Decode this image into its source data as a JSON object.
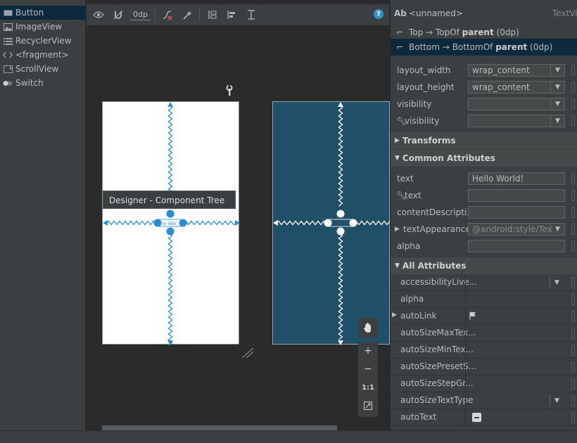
{
  "palette": {
    "items": [
      {
        "label": "Button",
        "icon": "button-icon",
        "selected": true
      },
      {
        "label": "ImageView",
        "icon": "image-icon",
        "selected": false
      },
      {
        "label": "RecyclerView",
        "icon": "list-icon",
        "selected": false
      },
      {
        "label": "<fragment>",
        "icon": "code-icon",
        "selected": false
      },
      {
        "label": "ScrollView",
        "icon": "scroll-icon",
        "selected": false
      },
      {
        "label": "Switch",
        "icon": "toggle-icon",
        "selected": false
      }
    ]
  },
  "toolbar": {
    "default_margin": "0dp",
    "help_label": "?"
  },
  "canvas": {
    "tooltip": "Designer - Component Tree",
    "widget_text": "lo Wor"
  },
  "zoom": {
    "zoom_in": "+",
    "zoom_out": "−",
    "actual_size": "1:1"
  },
  "attributes": {
    "component_prefix": "Ab",
    "component_name": "<unnamed>",
    "component_type": "TextView",
    "constraints": [
      {
        "text": "Top → TopOf ",
        "target": "parent",
        "margin": " (0dp)"
      },
      {
        "text": "Bottom → BottomOf ",
        "target": "parent",
        "margin": " (0dp)"
      }
    ],
    "layout": [
      {
        "name": "layout_width",
        "value": "wrap_content"
      },
      {
        "name": "layout_height",
        "value": "wrap_content"
      },
      {
        "name": "visibility",
        "value": ""
      },
      {
        "name": "visibility",
        "value": ""
      }
    ],
    "section_transforms": "Transforms",
    "section_common": "Common Attributes",
    "common": [
      {
        "name": "text",
        "value": "Hello World!"
      },
      {
        "name": "text",
        "value": ""
      },
      {
        "name": "contentDescripti...",
        "value": ""
      },
      {
        "name": "textAppearance",
        "value": "@android:style/Tex"
      },
      {
        "name": "alpha",
        "value": ""
      }
    ],
    "section_all": "All Attributes",
    "all": [
      {
        "name": "accessibilityLive..."
      },
      {
        "name": "alpha"
      },
      {
        "name": "autoLink"
      },
      {
        "name": "autoSizeMaxTex..."
      },
      {
        "name": "autoSizeMinTex..."
      },
      {
        "name": "autoSizePresetS..."
      },
      {
        "name": "autoSizeStepGr..."
      },
      {
        "name": "autoSizeTextType"
      },
      {
        "name": "autoText"
      }
    ]
  }
}
